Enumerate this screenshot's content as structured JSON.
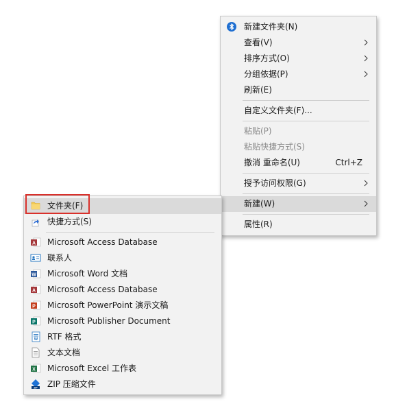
{
  "main_menu": {
    "items": [
      {
        "label": "新建文件夹(N)",
        "icon": "bluetooth-icon"
      },
      {
        "label": "查看(V)"
      },
      {
        "label": "排序方式(O)"
      },
      {
        "label": "分组依据(P)"
      },
      {
        "label": "刷新(E)"
      },
      {
        "label": "自定义文件夹(F)..."
      },
      {
        "label": "粘贴(P)"
      },
      {
        "label": "粘贴快捷方式(S)"
      },
      {
        "label": "撤消 重命名(U)",
        "shortcut": "Ctrl+Z"
      },
      {
        "label": "授予访问权限(G)"
      },
      {
        "label": "新建(W)"
      },
      {
        "label": "属性(R)"
      }
    ]
  },
  "sub_menu": {
    "items": [
      {
        "label": "文件夹(F)",
        "icon": "folder-icon"
      },
      {
        "label": "快捷方式(S)",
        "icon": "shortcut-icon"
      },
      {
        "label": "Microsoft Access Database",
        "icon": "access-icon"
      },
      {
        "label": "联系人",
        "icon": "contact-card-icon"
      },
      {
        "label": "Microsoft Word 文档",
        "icon": "word-icon"
      },
      {
        "label": "Microsoft Access Database",
        "icon": "access-icon"
      },
      {
        "label": "Microsoft PowerPoint 演示文稿",
        "icon": "powerpoint-icon"
      },
      {
        "label": "Microsoft Publisher Document",
        "icon": "publisher-icon"
      },
      {
        "label": "RTF 格式",
        "icon": "wordpad-icon"
      },
      {
        "label": "文本文档",
        "icon": "text-document-icon"
      },
      {
        "label": "Microsoft Excel 工作表",
        "icon": "excel-icon"
      },
      {
        "label": "ZIP 压缩文件",
        "icon": "zip-icon"
      }
    ]
  },
  "colors": {
    "menu_bg": "#f2f2f2",
    "hover_bg": "#dadada",
    "highlight_border": "#d9302b",
    "disabled_text": "#8a8a8a"
  }
}
